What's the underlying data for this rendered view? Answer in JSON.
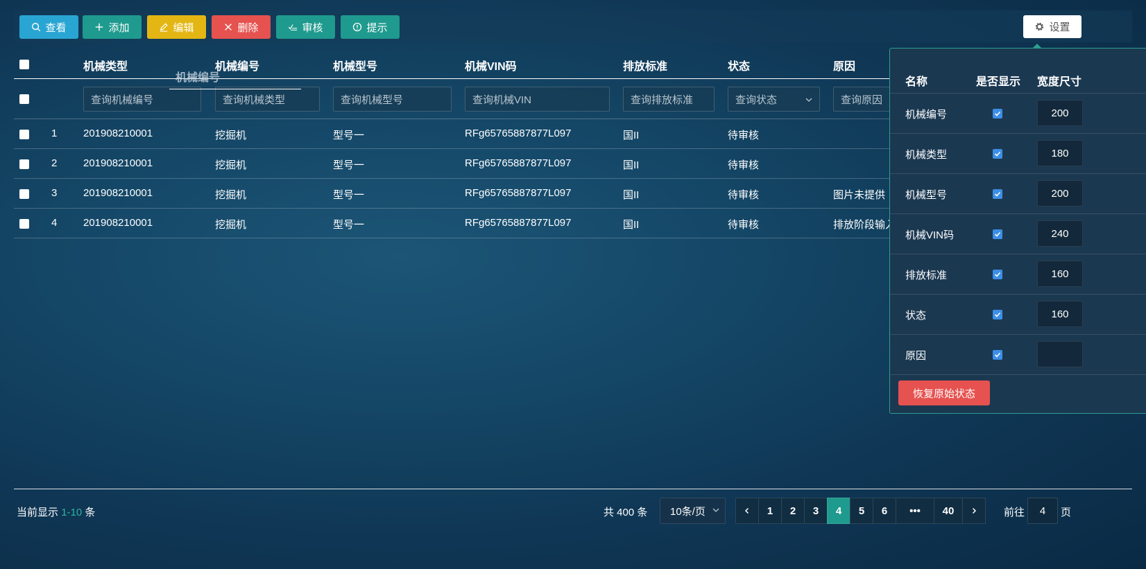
{
  "toolbar": {
    "view": "查看",
    "add": "添加",
    "edit": "编辑",
    "delete": "删除",
    "audit": "审核",
    "tip": "提示",
    "settings": "设置"
  },
  "table": {
    "headers": [
      "机械类型",
      "机械编号",
      "机械型号",
      "机械VIN码",
      "排放标准",
      "状态",
      "原因"
    ],
    "drag_ghost": "机械编号",
    "filters": [
      "查询机械编号",
      "查询机械类型",
      "查询机械型号",
      "查询机械VIN",
      "查询排放标准",
      "查询状态",
      "查询原因"
    ],
    "rows": [
      {
        "idx": "1",
        "no": "201908210001",
        "type": "挖掘机",
        "model": "型号一",
        "vin": "RFg65765887877L097",
        "std": "国II",
        "status": "待审核",
        "reason": ""
      },
      {
        "idx": "2",
        "no": "201908210001",
        "type": "挖掘机",
        "model": "型号一",
        "vin": "RFg65765887877L097",
        "std": "国II",
        "status": "待审核",
        "reason": ""
      },
      {
        "idx": "3",
        "no": "201908210001",
        "type": "挖掘机",
        "model": "型号一",
        "vin": "RFg65765887877L097",
        "std": "国II",
        "status": "待审核",
        "reason": "图片未提供"
      },
      {
        "idx": "4",
        "no": "201908210001",
        "type": "挖掘机",
        "model": "型号一",
        "vin": "RFg65765887877L097",
        "std": "国II",
        "status": "待审核",
        "reason": "排放阶段输入"
      }
    ]
  },
  "settings_panel": {
    "col_name": "名称",
    "col_show": "是否显示",
    "col_width": "宽度尺寸",
    "rows": [
      {
        "name": "机械编号",
        "checked": true,
        "width": "200"
      },
      {
        "name": "机械类型",
        "checked": true,
        "width": "180"
      },
      {
        "name": "机械型号",
        "checked": true,
        "width": "200"
      },
      {
        "name": "机械VIN码",
        "checked": true,
        "width": "240"
      },
      {
        "name": "排放标准",
        "checked": true,
        "width": "160"
      },
      {
        "name": "状态",
        "checked": true,
        "width": "160"
      },
      {
        "name": "原因",
        "checked": true,
        "width": ""
      }
    ],
    "reset": "恢复原始状态"
  },
  "footer": {
    "showing_prefix": "当前显示",
    "showing_range": "1-10",
    "showing_suffix": "条",
    "total": "共 400 条",
    "page_size": "10条/页",
    "pages": [
      "1",
      "2",
      "3",
      "4",
      "5",
      "6",
      "•••",
      "40"
    ],
    "current_page": "4",
    "goto_label": "前往",
    "goto_value": "4",
    "goto_unit": "页"
  },
  "colors": {
    "accent": "#1f9a8e",
    "view": "#29a5d3",
    "edit": "#e3b614",
    "danger": "#e5524f"
  }
}
